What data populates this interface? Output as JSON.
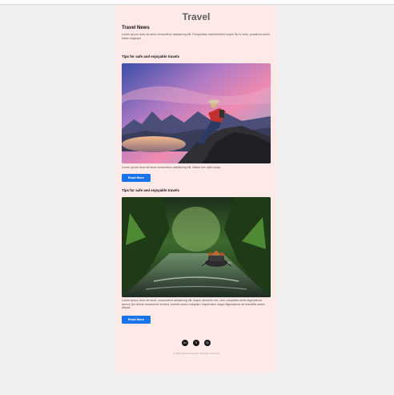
{
  "email": {
    "title": "Travel",
    "news_heading": "Travel News",
    "intro": "Lorem ipsum dolor sit amet consectetur adipisicing elit. Perspiciatis reprehenderit neque illo in enim, possimus animi totam magnam.",
    "articles": [
      {
        "title": "Tips for safe and enjoyable travels",
        "image_alt": "traveler-sitting-on-mountain-photo",
        "text": "Lorem ipsum dolor sit amet consectetur adipisicing elit. Natus iure optio culpa.",
        "button_label": "Read More"
      },
      {
        "title": "Tips for safe and enjoyable travels",
        "image_alt": "rafting-in-jungle-river-photo",
        "text": "Lorem ipsum dolor sit amet, consectetur adipisicing elit. Itaque deserunt est, vero voluptates amet dignissimos ipsum! Qui dolore laudantium tenetur, eveniet omnis voluptas? Aspernatur magni dignissimos ad blanditiis autem aliquid.",
        "button_label": "Read More"
      }
    ],
    "socials": [
      {
        "name": "linkedin-icon",
        "glyph": "in"
      },
      {
        "name": "x-twitter-icon",
        "glyph": "𝕏"
      },
      {
        "name": "instagram-icon",
        "glyph": "◎"
      }
    ],
    "footer": "© 2025 Travel Company. All rights reserved."
  },
  "colors": {
    "page_background": "#efefef",
    "email_background": "#fde9e8",
    "button": "#1a73e8",
    "title": "#5d5d5d"
  }
}
